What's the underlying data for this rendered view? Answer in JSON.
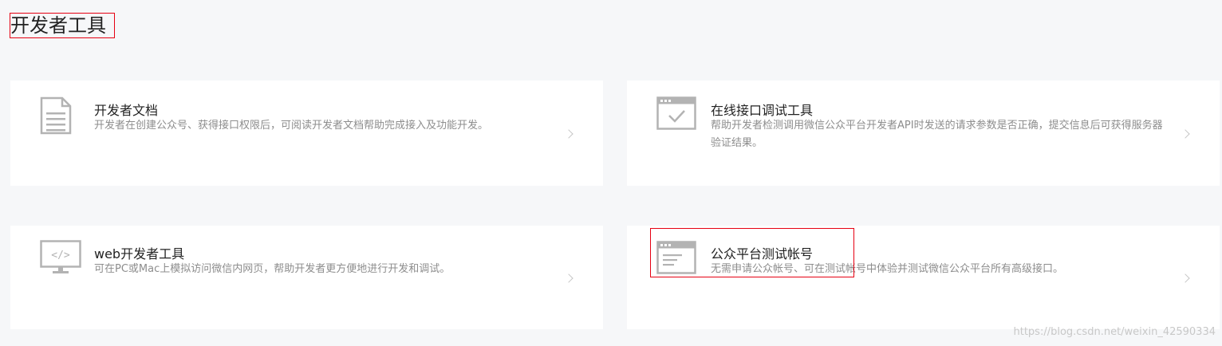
{
  "page": {
    "title": "开发者工具"
  },
  "cards": [
    {
      "title": "开发者文档",
      "desc": "开发者在创建公众号、获得接口权限后，可阅读开发者文档帮助完成接入及功能开发。",
      "icon": "document-icon"
    },
    {
      "title": "在线接口调试工具",
      "desc": "帮助开发者检测调用微信公众平台开发者API时发送的请求参数是否正确，提交信息后可获得服务器验证结果。",
      "icon": "check-window-icon"
    },
    {
      "title": "web开发者工具",
      "desc": "可在PC或Mac上模拟访问微信内网页，帮助开发者更方便地进行开发和调试。",
      "icon": "code-monitor-icon"
    },
    {
      "title": "公众平台测试帐号",
      "desc": "无需申请公众帐号、可在测试帐号中体验并测试微信公众平台所有高级接口。",
      "icon": "window-lines-icon"
    }
  ],
  "watermark": "https://blog.csdn.net/weixin_42590334",
  "colors": {
    "highlight": "#e60012",
    "icon": "#b3b3b3",
    "background": "#f6f7f9"
  }
}
